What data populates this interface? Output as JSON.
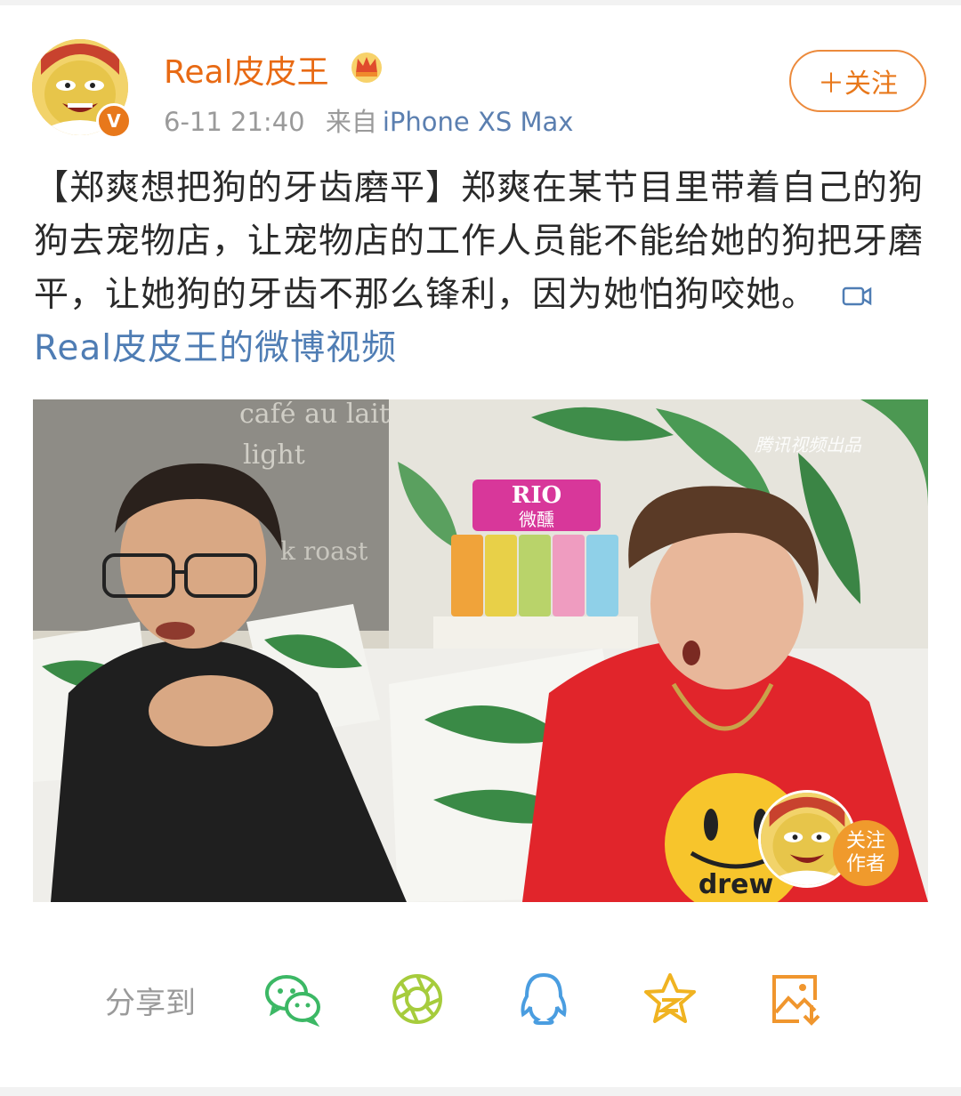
{
  "post": {
    "username": "Real皮皮王",
    "time": "6-11 21:40",
    "source_prefix": "来自",
    "device": "iPhone XS Max",
    "follow_label": "＋关注",
    "text": "【郑爽想把狗的牙齿磨平】郑爽在某节目里带着自己的狗狗去宠物店，让宠物店的工作人员能不能给她的狗把牙磨平，让她狗的牙齿不那么锋利，因为她怕狗咬她。",
    "video_link": "Real皮皮王的微博视频",
    "verified_badge": "V"
  },
  "video": {
    "watermark": "腾讯视频出品",
    "brand_sign_top": "RIO",
    "brand_sign_bottom": "微醺",
    "wall_text_1": "café au lait",
    "wall_text_2": "light",
    "wall_text_3": "k roast",
    "shirt_text": "drew",
    "follow_author_line1": "关注",
    "follow_author_line2": "作者"
  },
  "share": {
    "label": "分享到",
    "targets": [
      "wechat",
      "moments",
      "qq",
      "qzone",
      "save-image"
    ]
  },
  "colors": {
    "accent": "#e8781b",
    "link": "#4f7db4",
    "wechat": "#3cb865",
    "moments": "#a6cc3c",
    "qq": "#4a9de0",
    "qzone": "#f0b321",
    "save": "#f0962e"
  }
}
